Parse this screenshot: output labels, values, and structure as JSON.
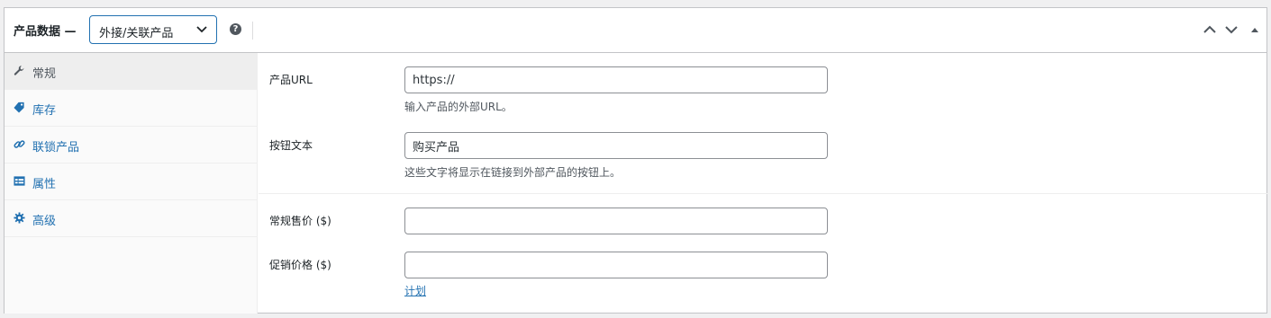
{
  "header": {
    "title": "产品数据 —",
    "product_type": "外接/关联产品",
    "help": "?"
  },
  "tabs": [
    {
      "label": "常规",
      "icon": "wrench-icon",
      "active": true
    },
    {
      "label": "库存",
      "icon": "tag-icon",
      "active": false
    },
    {
      "label": "联锁产品",
      "icon": "link-icon",
      "active": false
    },
    {
      "label": "属性",
      "icon": "table-icon",
      "active": false
    },
    {
      "label": "高级",
      "icon": "gear-icon",
      "active": false
    }
  ],
  "fields": {
    "product_url": {
      "label": "产品URL",
      "value": "https://",
      "description": "输入产品的外部URL。"
    },
    "button_text": {
      "label": "按钮文本",
      "value": "购买产品",
      "description": "这些文字将显示在链接到外部产品的按钮上。"
    },
    "regular_price": {
      "label": "常规售价 ($)",
      "value": ""
    },
    "sale_price": {
      "label": "促销价格 ($)",
      "value": ""
    },
    "schedule_link": "计划"
  },
  "colors": {
    "accent": "#2271b1",
    "border": "#c3c4c7",
    "text": "#1d2327"
  }
}
